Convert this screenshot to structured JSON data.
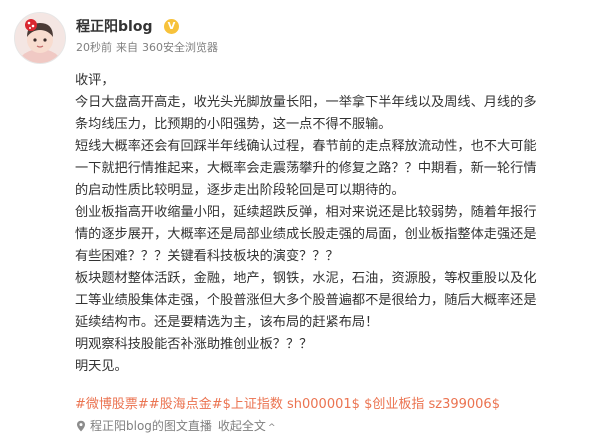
{
  "post": {
    "author": "程正阳blog",
    "verified_badge": "V",
    "time": "20秒前",
    "source_prefix": "来自",
    "source": "360安全浏览器",
    "content_lines": [
      "收评，",
      "今日大盘高开高走，收光头光脚放量长阳，一举拿下半年线以及周线、月线的多",
      "条均线压力，比预期的小阳强势，这一点不得不服输。",
      "短线大概率还会有回踩半年线确认过程，春节前的走点释放流动性，也不大可能",
      "一下就把行情推起来，大概率会走震荡攀升的修复之路？？中期看，新一轮行情",
      "的启动性质比较明显，逐步走出阶段轮回是可以期待的。",
      "创业板指高开收缩量小阳，延续超跌反弹，相对来说还是比较弱势，随着年报行",
      "情的逐步展开，大概率还是局部业绩成长股走强的局面，创业板指整体走强还是",
      "有些困难？？？关键看科技板块的演变？？？",
      "板块题材整体活跃，金融，地产，钢铁，水泥，石油，资源股，等权重股以及化",
      "工等业绩股集体走强，个股普涨但大多个股普遍都不是很给力，随后大概率还是",
      "延续结构市。还是要精选为主，该布局的赶紧布局！",
      "明观察科技股能否补涨助推创业板？？？",
      "明天见。"
    ],
    "tags": [
      "#微博股票#",
      "#股海点金#",
      "$上证指数 sh000001$",
      "$创业板指 sz399006$"
    ],
    "footer": {
      "pin_icon": "location-pin-icon",
      "live_link": "程正阳blog的图文直播",
      "collapse": "收起全文",
      "arrow": "^"
    }
  },
  "colors": {
    "tag": "#eb7350",
    "meta": "#808080",
    "badge": "#f7c23b",
    "text": "#333333"
  }
}
